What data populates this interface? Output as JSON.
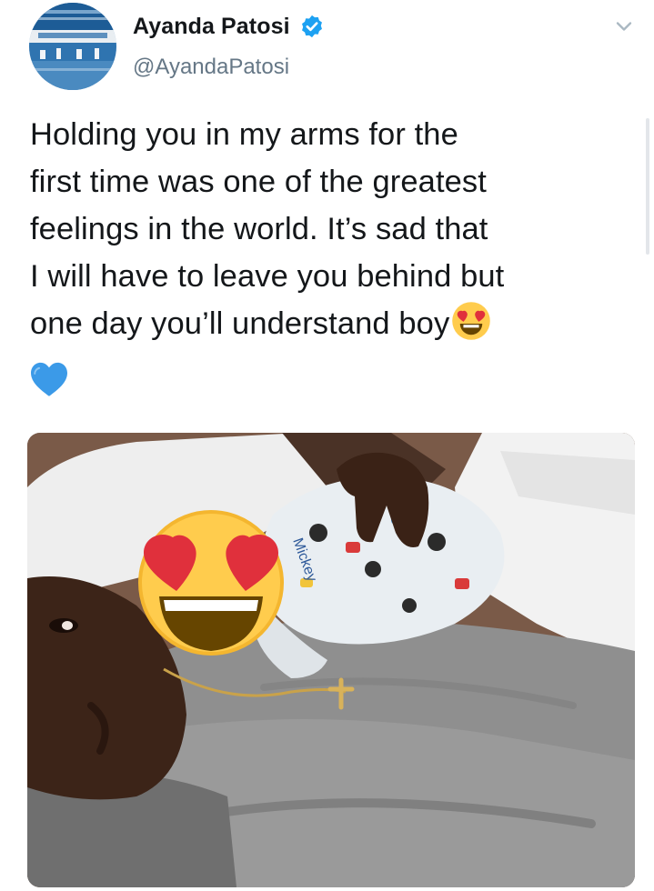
{
  "tweet": {
    "author": {
      "display_name": "Ayanda Patosi",
      "handle": "@AyandaPatosi",
      "verified": true,
      "avatar": "avatar-stadium-image"
    },
    "text_lines": [
      "Holding you in my arms for the",
      "first time was one of the greatest",
      "feelings in the world. It’s sad that",
      "I will have to leave you behind but",
      "one day you’ll understand boy"
    ],
    "emojis": [
      "smiling-face-with-heart-eyes",
      "blue-heart"
    ],
    "media": {
      "image_type": "photo",
      "visible_text": "Mickey",
      "overlay_emoji": "smiling-face-with-heart-eyes"
    },
    "more_menu_icon": "chevron-down-icon"
  },
  "colors": {
    "text": "#14171a",
    "secondary_text": "#657786",
    "verified_blue": "#1da1f2",
    "heart_blue": "#3b9ae8",
    "emoji_yellow": "#ffcc4d",
    "emoji_heart_red": "#e0303c"
  }
}
